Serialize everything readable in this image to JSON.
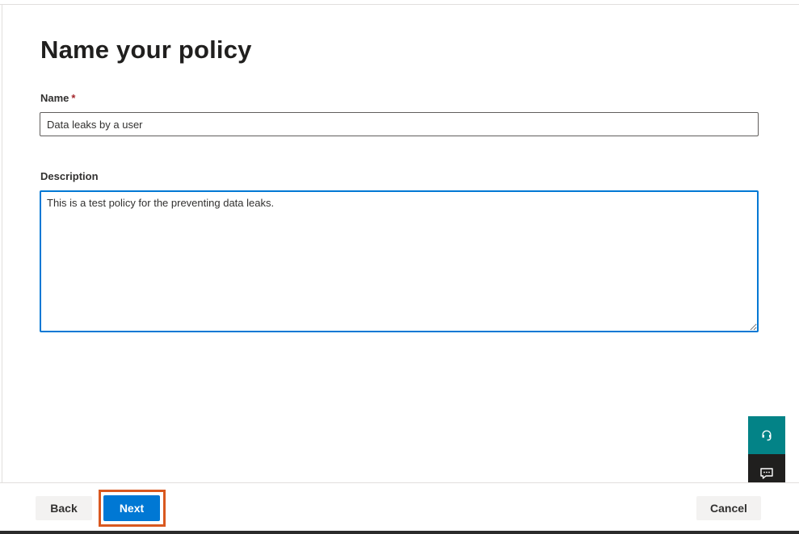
{
  "header": {
    "title": "Name your policy"
  },
  "form": {
    "name": {
      "label": "Name",
      "required_mark": "*",
      "value": "Data leaks by a user"
    },
    "description": {
      "label": "Description",
      "value": "This is a test policy for the preventing data leaks."
    }
  },
  "footer": {
    "back_label": "Back",
    "next_label": "Next",
    "cancel_label": "Cancel"
  },
  "side_panel": {
    "help_icon": "headset-icon",
    "feedback_icon": "chat-feedback-icon"
  },
  "colors": {
    "primary": "#0078d4",
    "highlight": "#d9581f",
    "help_bg": "#038387",
    "feedback_bg": "#201f1e",
    "required": "#a4262c"
  }
}
